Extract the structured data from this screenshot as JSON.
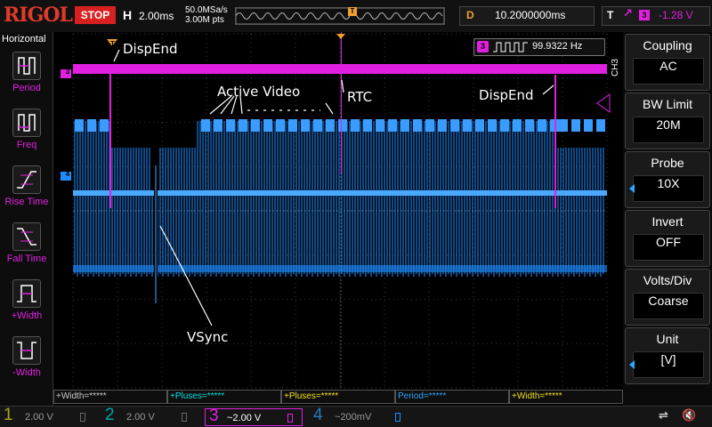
{
  "topbar": {
    "logo": "RIGOL",
    "run_state": "STOP",
    "timebase_letter": "H",
    "timebase_scale": "2.00ms",
    "sample_rate": "50.0MSa/s",
    "memory_depth": "3.00M pts",
    "trigger_marker": "T",
    "delay_letter": "D",
    "delay_value": "10.2000000ms",
    "trigger_letter": "T",
    "trigger_edge": "↗",
    "trigger_channel": "3",
    "trigger_level": "-1.28 V"
  },
  "left_menu": {
    "title": "Horizontal",
    "items": [
      {
        "label": "Period",
        "icon": "period-icon"
      },
      {
        "label": "Freq",
        "icon": "frequency-icon"
      },
      {
        "label": "Rise Time",
        "icon": "rise-time-icon"
      },
      {
        "label": "Fall Time",
        "icon": "fall-time-icon"
      },
      {
        "label": "+Width",
        "icon": "positive-width-icon"
      },
      {
        "label": "-Width",
        "icon": "negative-width-icon"
      }
    ]
  },
  "plot": {
    "trigger_marker": "T",
    "channel_markers": [
      "3",
      "4"
    ],
    "frequency_channel": "3",
    "frequency_value": "99.9322 Hz",
    "vertical_tag": "CH3",
    "annotations": {
      "dispend_left": "DispEnd",
      "active_video": "Active Video",
      "rtc": "RTC",
      "dispend_right": "DispEnd",
      "vsync": "VSync"
    }
  },
  "right_menu": {
    "items": [
      {
        "title": "Coupling",
        "value": "AC",
        "has_arrow": false
      },
      {
        "title": "BW Limit",
        "value": "20M",
        "has_arrow": false
      },
      {
        "title": "Probe",
        "value": "10X",
        "has_arrow": true
      },
      {
        "title": "Invert",
        "value": "OFF",
        "has_arrow": false
      },
      {
        "title": "Volts/Div",
        "value": "Coarse",
        "has_arrow": false
      },
      {
        "title": "Unit",
        "value": "[V]",
        "has_arrow": true
      }
    ]
  },
  "measurements": [
    {
      "text": "+Width=*****",
      "color": "#cccccc"
    },
    {
      "text": "+Pluses=*****",
      "color": "#00e0e0"
    },
    {
      "text": "+Pluses=*****",
      "color": "#f0e020"
    },
    {
      "text": "Period=*****",
      "color": "#29a8ff"
    },
    {
      "text": "+Width=*****",
      "color": "#f0e020"
    }
  ],
  "channels": [
    {
      "num": "1",
      "value": "2.00 V",
      "color": "#f0e020",
      "active": false
    },
    {
      "num": "2",
      "value": "2.00 V",
      "color": "#00e0e0",
      "active": false
    },
    {
      "num": "3",
      "value": "~2.00 V",
      "color": "#e020e0",
      "active": true
    },
    {
      "num": "4",
      "value": "~200mV",
      "color": "#29a8ff",
      "active": false
    }
  ],
  "colors": {
    "ch3": "#e020e0",
    "ch4": "#1e8cff",
    "trigger": "#f0a030",
    "stop": "#d82020"
  },
  "status_icons": {
    "usb": "usb-icon",
    "mute": "speaker-mute-icon"
  }
}
